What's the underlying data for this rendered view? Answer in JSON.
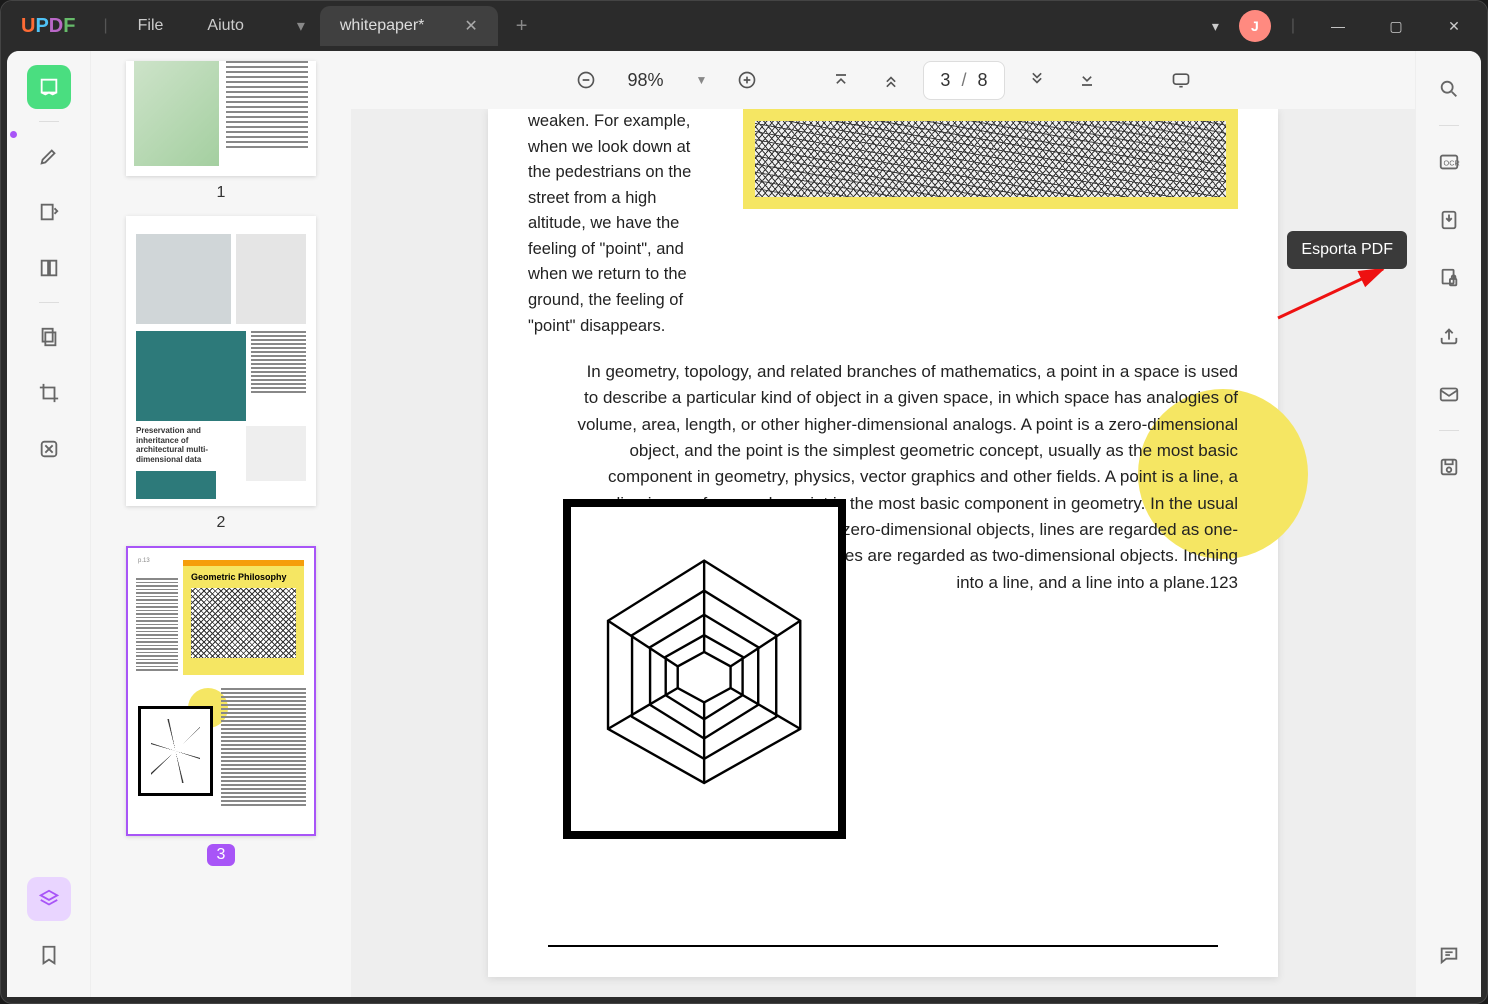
{
  "menu": {
    "file": "File",
    "help": "Aiuto"
  },
  "tab": {
    "title": "whitepaper*"
  },
  "avatar": {
    "initial": "J"
  },
  "toolbar": {
    "zoom": "98%",
    "page_current": "3",
    "page_sep": "/",
    "page_total": "8"
  },
  "thumbnails": {
    "p1": "1",
    "p2": "2",
    "p3": "3",
    "thumb2_title": "Preservation and inheritance of architectural multi-dimensional data",
    "thumb3_title": "Geometric Philosophy"
  },
  "content": {
    "para1": "weaken. For example, when we look down at the pedestrians on the street from a high altitude, we have the feeling of \"point\", and when we return to the ground, the feeling of \"point\" disappears.",
    "para2": "In geometry, topology, and related branches of mathematics, a point in a space is used to describe a particular kind of object in a given space, in which space has analogies of volume, area, length, or other higher-dimensional analogs. A point is a zero-dimensional object, and the point is the simplest geometric concept, usually as the most basic component in geometry, physics, vector graphics and other fields. A point is a line, a line is a surface, and a point is the most basic component in geometry. In the usual sense, points are regarded as zero-dimensional objects, lines are regarded as one-dimensional objects, and surfaces are regarded as two-dimensional objects. Inching into a line, and a line into a plane.123"
  },
  "tooltip": {
    "export": "Esporta PDF"
  }
}
